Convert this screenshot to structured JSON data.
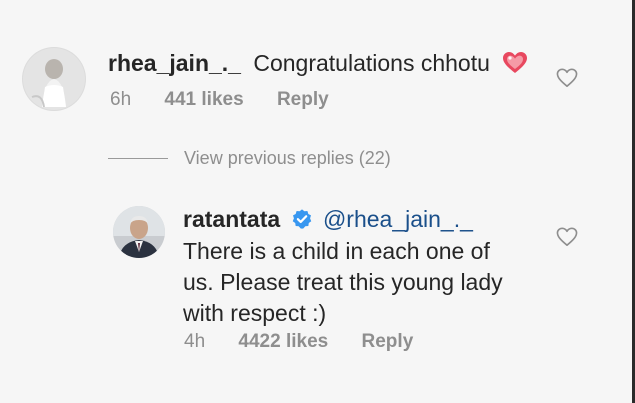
{
  "comments": [
    {
      "username": "rhea_jain_._",
      "text": "Congratulations chhotu",
      "emoji": "sparkling-heart",
      "time": "6h",
      "likes": "441 likes",
      "reply": "Reply"
    },
    {
      "username": "ratantata",
      "verified": true,
      "mention": "@rhea_jain_._",
      "text_lines": [
        "There is a child in each one of",
        "us. Please treat this young lady",
        "with respect :)"
      ],
      "time": "4h",
      "likes": "4422 likes",
      "reply": "Reply"
    }
  ],
  "view_previous_replies": "View previous replies (22)",
  "colors": {
    "verified_blue": "#3897f0",
    "mention": "#1a4f8a",
    "meta_gray": "#8e8e8e",
    "heart_pink": "#e8485f"
  },
  "icons": [
    "heart-icon",
    "verified-badge-icon",
    "sparkling-heart-icon"
  ]
}
